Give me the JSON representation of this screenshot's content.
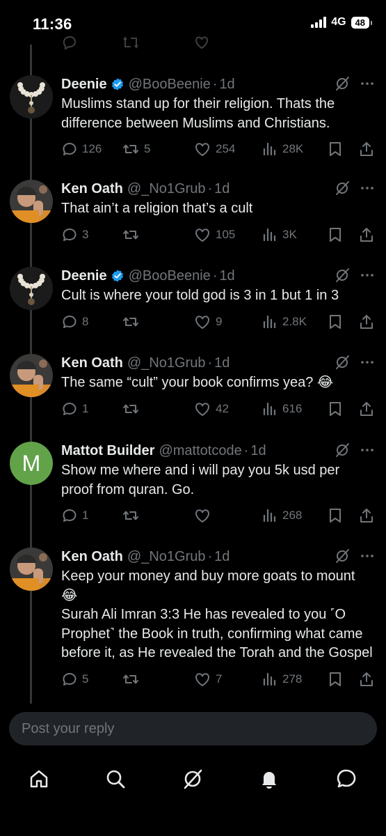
{
  "status_bar": {
    "time": "11:36",
    "network": "4G",
    "battery": "48"
  },
  "tweets": [
    {
      "avatar": "rosary-beads",
      "name": "Deenie",
      "verified": true,
      "handle": "@BooBeenie",
      "time": "1d",
      "lines": [
        "Muslims stand up for their religion. Thats the difference between Muslims and Christians."
      ],
      "replies": "126",
      "reposts": "5",
      "likes": "254",
      "views": "28K"
    },
    {
      "avatar": "ken-photo",
      "name": "Ken Oath",
      "verified": false,
      "handle": "@_No1Grub",
      "time": "1d",
      "lines": [
        "That ain’t a religion that’s a cult"
      ],
      "replies": "3",
      "reposts": "",
      "likes": "105",
      "views": "3K"
    },
    {
      "avatar": "rosary-beads",
      "name": "Deenie",
      "verified": true,
      "handle": "@BooBeenie",
      "time": "1d",
      "lines": [
        "Cult is where your told god is 3 in 1 but 1 in 3"
      ],
      "replies": "8",
      "reposts": "",
      "likes": "9",
      "views": "2.8K"
    },
    {
      "avatar": "ken-photo",
      "name": "Ken Oath",
      "verified": false,
      "handle": "@_No1Grub",
      "time": "1d",
      "lines": [
        "The same “cult” your book confirms yea? 😂"
      ],
      "replies": "1",
      "reposts": "",
      "likes": "42",
      "views": "616"
    },
    {
      "avatar": "letter-m",
      "avatar_letter": "M",
      "name": "Mattot Builder",
      "verified": false,
      "handle": "@mattotcode",
      "time": "1d",
      "lines": [
        "Show me where and i will pay you 5k usd per proof from quran. Go."
      ],
      "replies": "1",
      "reposts": "",
      "likes": "",
      "views": "268"
    },
    {
      "avatar": "ken-photo",
      "name": "Ken Oath",
      "verified": false,
      "handle": "@_No1Grub",
      "time": "1d",
      "lines": [
        "Keep your money and buy more goats to mount 😂",
        "Surah Ali Imran 3:3 He has revealed to you ˹O Prophet˺ the Book in truth, confirming what came before it, as He revealed the Torah and the Gospel"
      ],
      "replies": "5",
      "reposts": "",
      "likes": "7",
      "views": "278"
    }
  ],
  "reply_box": {
    "placeholder": "Post your reply"
  },
  "nav": [
    "home-icon",
    "search-icon",
    "grok-icon",
    "notifications-icon",
    "messages-icon"
  ],
  "colors": {
    "background": "#000000",
    "text": "#e7e9ea",
    "muted": "#71767b",
    "verified": "#1d9bf0",
    "input_bg": "#202327"
  }
}
